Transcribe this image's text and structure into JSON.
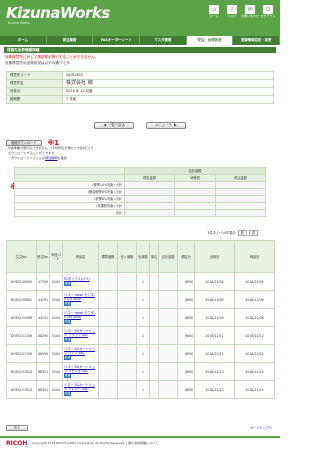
{
  "header": {
    "logo": "KizunaWorks",
    "logo_sub": "Kizuna Works",
    "top_nav": [
      {
        "label": "ホーム",
        "icon": "⌂"
      },
      {
        "label": "ヘルプ",
        "icon": "?"
      },
      {
        "label": "お問い合わせ",
        "icon": "✉"
      },
      {
        "label": "ログアウト",
        "icon": "⏻"
      }
    ],
    "tabs": [
      {
        "label": "ホーム",
        "active": false
      },
      {
        "label": "発注業務",
        "active": false
      },
      {
        "label": "FAXオーダーシート",
        "active": false
      },
      {
        "label": "マスタ管理",
        "active": false
      },
      {
        "label": "受注・出荷状況",
        "active": true
      },
      {
        "label": "登録情報設定・変更",
        "active": false
      }
    ]
  },
  "page_title": "得意先出荷情報詳細",
  "notice_red": "対象得意先に対して請求書を発行することができません。",
  "notice": "対象得意先の出荷状況は以下の通りです。",
  "info": {
    "rows": [
      {
        "label": "得意先コード",
        "value": "00042602"
      },
      {
        "label": "得意先名",
        "value": "株式会社 御"
      },
      {
        "label": "対象月",
        "value": "2018 年 12 月度"
      },
      {
        "label": "締期間",
        "value": "7 月締"
      }
    ]
  },
  "buttons": {
    "back": "一覧へ戻る",
    "menu": "メニューへ"
  },
  "download": {
    "button": "明細ダウンロード",
    "mark1": "※1",
    "mark2": "※2",
    "notes": [
      "※請求書の発行はできません。CSV形式(半角カンマ区切り)で",
      "ダウンロードすることができます。",
      "・ダウンロードファイルの"
    ],
    "link": "項目説明",
    "link_suffix": "を確認"
  },
  "summary": {
    "title": "合計金額",
    "headers": [
      "税抜金額",
      "消費税",
      "税込金額"
    ],
    "rows": [
      {
        "label": "(税率10%対象) 小計",
        "v": [
          "",
          "",
          ""
        ]
      },
      {
        "label": "(軽減税率8%対象) 小計",
        "v": [
          "",
          "",
          ""
        ]
      },
      {
        "label": "(税率8%対象) 小計",
        "v": [
          "",
          "",
          ""
        ]
      },
      {
        "label": "(非課税対象) 小計",
        "v": [
          "",
          "",
          ""
        ]
      },
      {
        "label": "合計",
        "v": [
          "",
          "",
          ""
        ]
      }
    ]
  },
  "pager": {
    "text": "1件中 1〜10件表示",
    "prev": "前",
    "next": "次"
  },
  "detail": {
    "headers": [
      "注文No.",
      "受注No.",
      "商品コード",
      "商品名",
      "標準価格",
      "仕入価格",
      "出荷数",
      "単位",
      "合計金額",
      "税区分",
      "出荷日",
      "納品日"
    ],
    "rows": [
      {
        "order": "DOES149069",
        "recv": "47750",
        "code": "5204",
        "name": "PCボックス(パリ)",
        "tag": "軽減",
        "price": "",
        "cost": "",
        "qty": "1",
        "unit": "",
        "total": "",
        "tax": "¥800",
        "ship": "2018/12/04",
        "deliv": "2018/12/05"
      },
      {
        "order": "DOES150081",
        "recv": "44291",
        "code": "5104",
        "name": "リコー mesh モニタ-S GH 4000",
        "tag": "軽減",
        "price": "",
        "cost": "",
        "qty": "1",
        "unit": "",
        "total": "",
        "tax": "¥800",
        "ship": "2018/12/05",
        "deliv": "2018/12/06"
      },
      {
        "order": "DOES150098",
        "recv": "44291",
        "code": "5104",
        "name": "リコー mesh モニタ-S GH 4000",
        "tag": "軽減",
        "price": "",
        "cost": "",
        "qty": "1",
        "unit": "",
        "total": "",
        "tax": "¥800",
        "ship": "2018/12/05",
        "deliv": "2018/12/06"
      },
      {
        "order": "DOES151726",
        "recv": "88295",
        "code": "5104",
        "name": "リコー SGカートリッジ ブラック 4XC",
        "tag": "軽減",
        "price": "",
        "cost": "",
        "qty": "1",
        "unit": "",
        "total": "",
        "tax": "¥800",
        "ship": "2018/12/11",
        "deliv": "2018/12/12"
      },
      {
        "order": "DOES151726",
        "recv": "88295",
        "code": "5104",
        "name": "リコー SGカートリッジ シアン 4XC",
        "tag": "軽減",
        "price": "",
        "cost": "",
        "qty": "1",
        "unit": "",
        "total": "",
        "tax": "¥800",
        "ship": "2018/12/11",
        "deliv": "2018/12/12"
      },
      {
        "order": "DOES151814",
        "recv": "88301",
        "code": "5104",
        "name": "リコー SGカートリッジ マゼンタ 4XC",
        "tag": "軽減",
        "price": "",
        "cost": "",
        "qty": "1",
        "unit": "",
        "total": "",
        "tax": "¥800",
        "ship": "2018/12/13",
        "deliv": "2018/12/14"
      },
      {
        "order": "DOES151814",
        "recv": "88301",
        "code": "5104",
        "name": "リコー SGカートリッジ イエロー 4XC",
        "tag": "軽減",
        "price": "",
        "cost": "",
        "qty": "1",
        "unit": "",
        "total": "",
        "tax": "¥800",
        "ship": "2018/12/13",
        "deliv": "2018/12/14"
      }
    ]
  },
  "bottom": {
    "back": "戻る",
    "top": "ページトップへ"
  },
  "footer": {
    "logo": "RICOH",
    "copy": "Copyright 2018 RICOH JAPAN Corporation All Rights Reserved. | 個人情報保護について"
  }
}
